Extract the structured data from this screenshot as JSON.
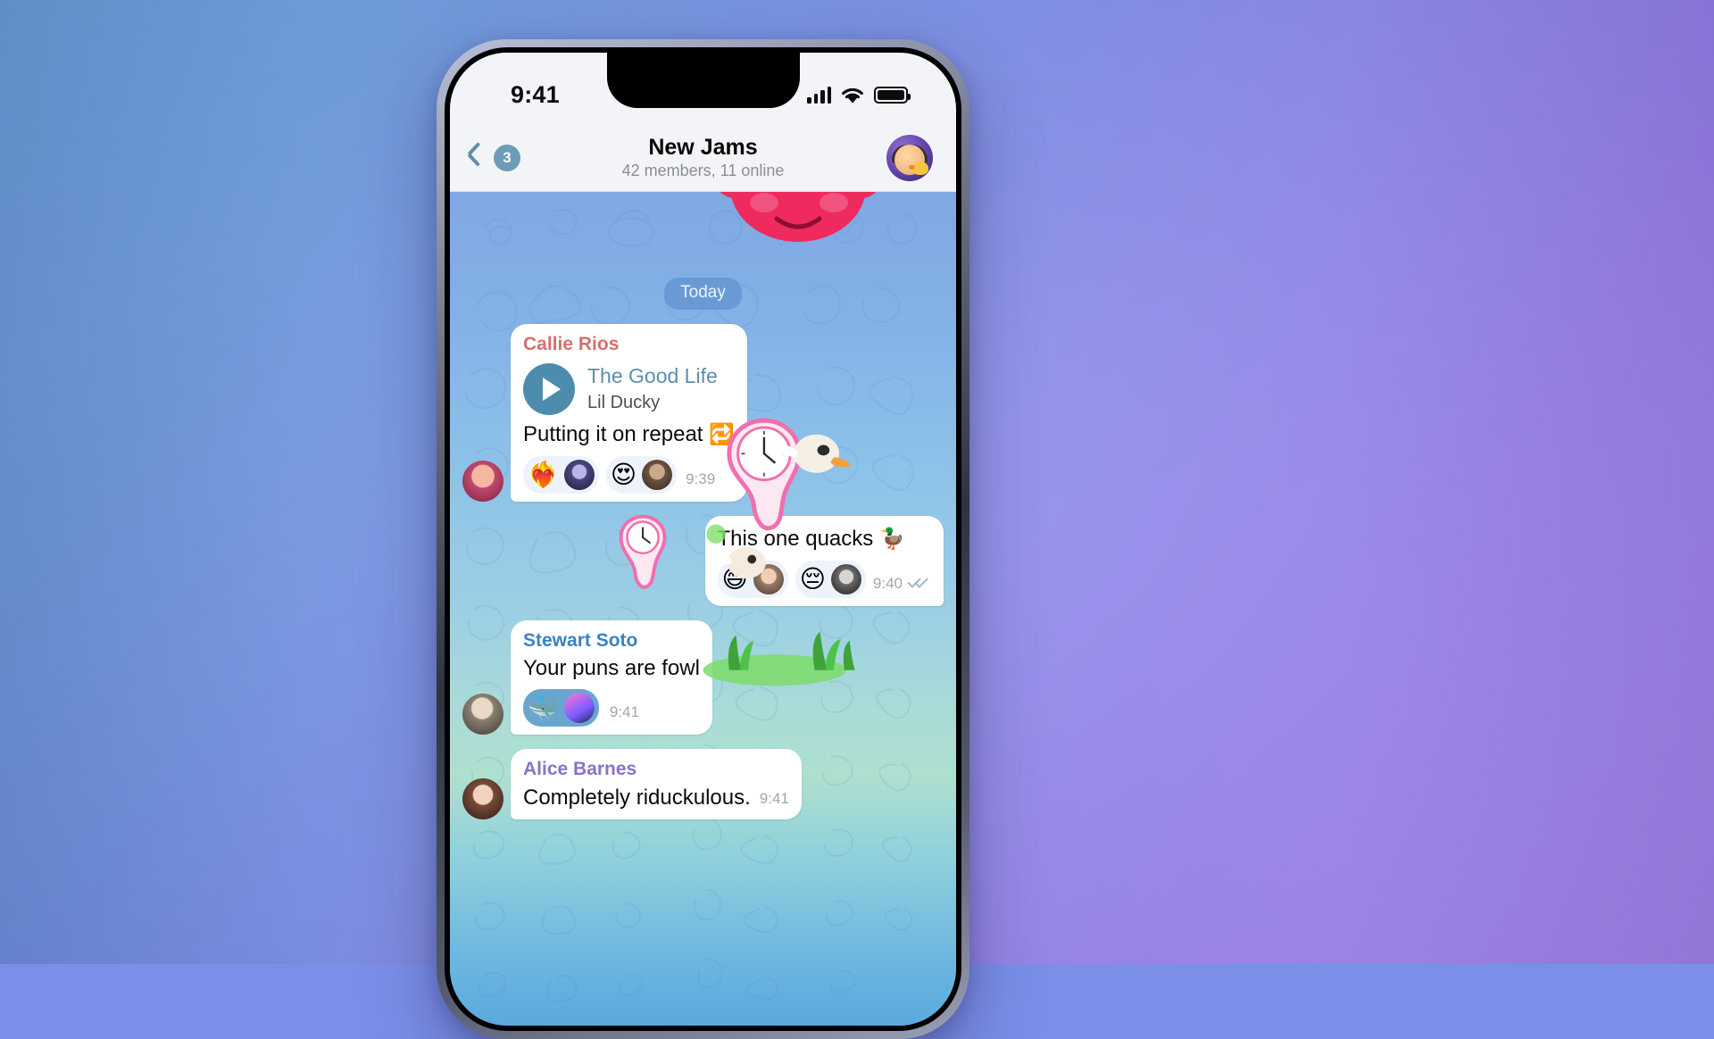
{
  "status_bar": {
    "time": "9:41",
    "signal_icon": "cellular-signal-icon",
    "wifi_icon": "wifi-icon",
    "battery_icon": "battery-icon"
  },
  "nav_bar": {
    "back_icon": "chevron-left-icon",
    "unread_badge": "3",
    "title": "New Jams",
    "subtitle": "42 members, 11 online",
    "avatar_name": "profile-avatar"
  },
  "chat": {
    "date_divider": "Today",
    "messages": [
      {
        "id": "msg-music",
        "direction": "in",
        "sender": "Callie Rios",
        "sender_color": "#d4706f",
        "track_title": "The Good Life",
        "track_artist": "Lil Ducky",
        "text": "Putting it on repeat",
        "trailing_emoji": "🔁",
        "time": "9:39",
        "reactions": [
          {
            "emoji": "❤️‍🔥",
            "avatar": "reaction-avatar-1",
            "selected": false
          },
          {
            "emoji": "😍",
            "avatar": "reaction-avatar-2",
            "selected": false
          }
        ]
      },
      {
        "id": "msg-quacks",
        "direction": "out",
        "sender": "",
        "text": "This one quacks",
        "trailing_emoji": "🦆",
        "time": "9:40",
        "status_icon": "double-check-icon",
        "reactions": [
          {
            "emoji": "😅",
            "avatar": "reaction-avatar-3",
            "selected": false
          },
          {
            "emoji": "😔",
            "avatar": "reaction-avatar-4",
            "selected": false
          }
        ]
      },
      {
        "id": "msg-puns",
        "direction": "in",
        "sender": "Stewart Soto",
        "sender_color": "#3b82c4",
        "text": "Your puns are fowl",
        "time": "9:41",
        "reactions": [
          {
            "emoji": "🐳",
            "avatar": "reaction-avatar-5",
            "selected": true
          }
        ]
      },
      {
        "id": "msg-riduckulous",
        "direction": "in",
        "sender": "Alice Barnes",
        "sender_color": "#8a72c8",
        "text": "Completely riduckulous.",
        "time": "9:41",
        "reactions": []
      }
    ]
  },
  "stickers": {
    "top_sticker": "pink-character-sticker",
    "melting_clock": "melting-clock-sticker",
    "duck_head": "duck-head-sticker",
    "grass": "grass-sticker"
  },
  "colors": {
    "accent_blue": "#5d8faa",
    "badge_blue": "#6d9cb8",
    "reaction_selected": "#69a6cf",
    "nav_bg": "#f2f4f7"
  }
}
